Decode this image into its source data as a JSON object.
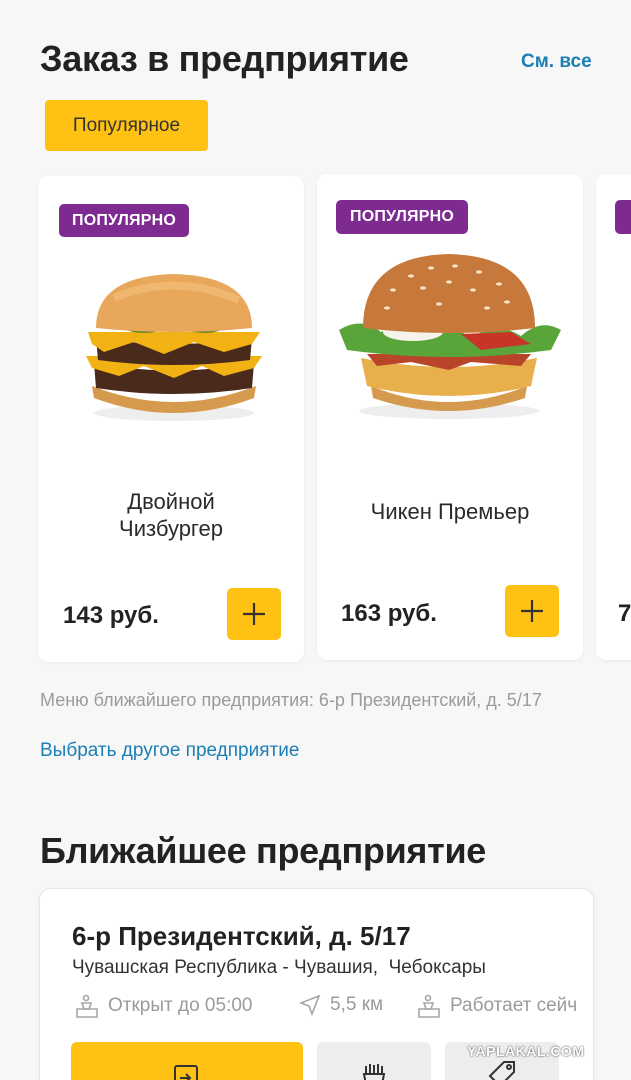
{
  "order_section": {
    "title": "Заказ в предприятие",
    "see_all": "См. все",
    "filter_chip": "Популярное"
  },
  "products": [
    {
      "badge": "ПОПУЛЯРНО",
      "name_line1": "Двойной",
      "name_line2": "Чизбургер",
      "price": "143 руб."
    },
    {
      "badge": "ПОПУЛЯРНО",
      "name_line1": "Чикен Премьер",
      "price": "163 руб."
    },
    {
      "price_partial": "7"
    }
  ],
  "menu_info": {
    "text": "Меню ближайшего предприятия: 6-р Президентский, д. 5/17",
    "change_link": "Выбрать другое предприятие"
  },
  "nearest_section": {
    "title": "Ближайшее предприятие",
    "restaurant": {
      "name": "6-р Президентский, д. 5/17",
      "region": "Чувашская Республика - Чувашия,",
      "city": "Чебоксары",
      "hours": "Открыт до 05:00",
      "distance": "5,5 км",
      "status": "Работает сейч"
    }
  },
  "watermark": "YAPLAKAL.COM",
  "colors": {
    "accent": "#ffc114",
    "badge": "#7d2b91",
    "link": "#1b7fb4"
  }
}
